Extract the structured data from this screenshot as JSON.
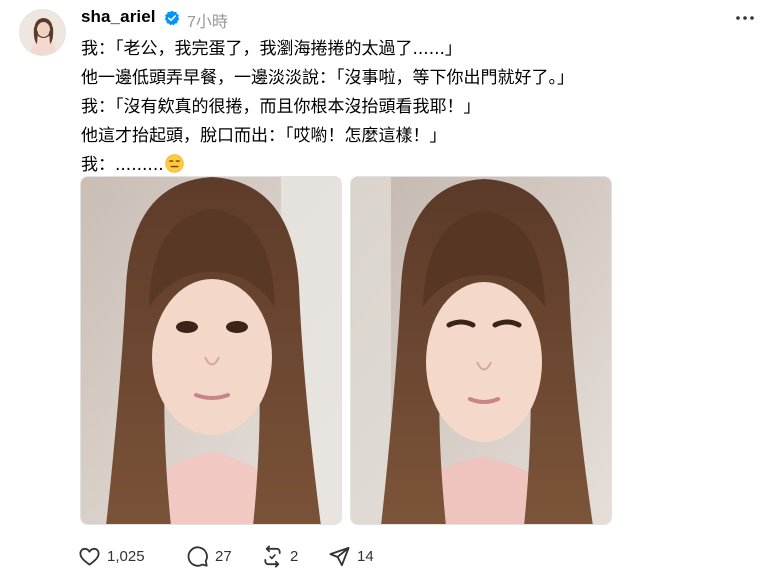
{
  "post": {
    "username": "sha_ariel",
    "verified_icon": "verified-badge-icon",
    "timestamp": "7小時",
    "lines": [
      "我：「老公，我完蛋了，我瀏海捲捲的太過了......」",
      "他一邊低頭弄早餐，一邊淡淡說：「沒事啦，等下你出門就好了。」",
      "我：「沒有欸真的很捲，而且你根本沒抬頭看我耶！」",
      "他這才抬起頭，脫口而出：「哎喲！怎麼這樣！」",
      "我：........."
    ],
    "emoji": "expressionless-face-emoji",
    "photos": [
      "selfie-photo",
      "selfie-photo"
    ]
  },
  "actions": {
    "like": {
      "icon": "heart-icon",
      "count": "1,025"
    },
    "comment": {
      "icon": "comment-icon",
      "count": "27"
    },
    "repost": {
      "icon": "repost-icon",
      "count": "2"
    },
    "share": {
      "icon": "send-icon",
      "count": "14"
    }
  },
  "colors": {
    "text": "#000000",
    "muted": "#999999",
    "verified": "#0095f6"
  }
}
